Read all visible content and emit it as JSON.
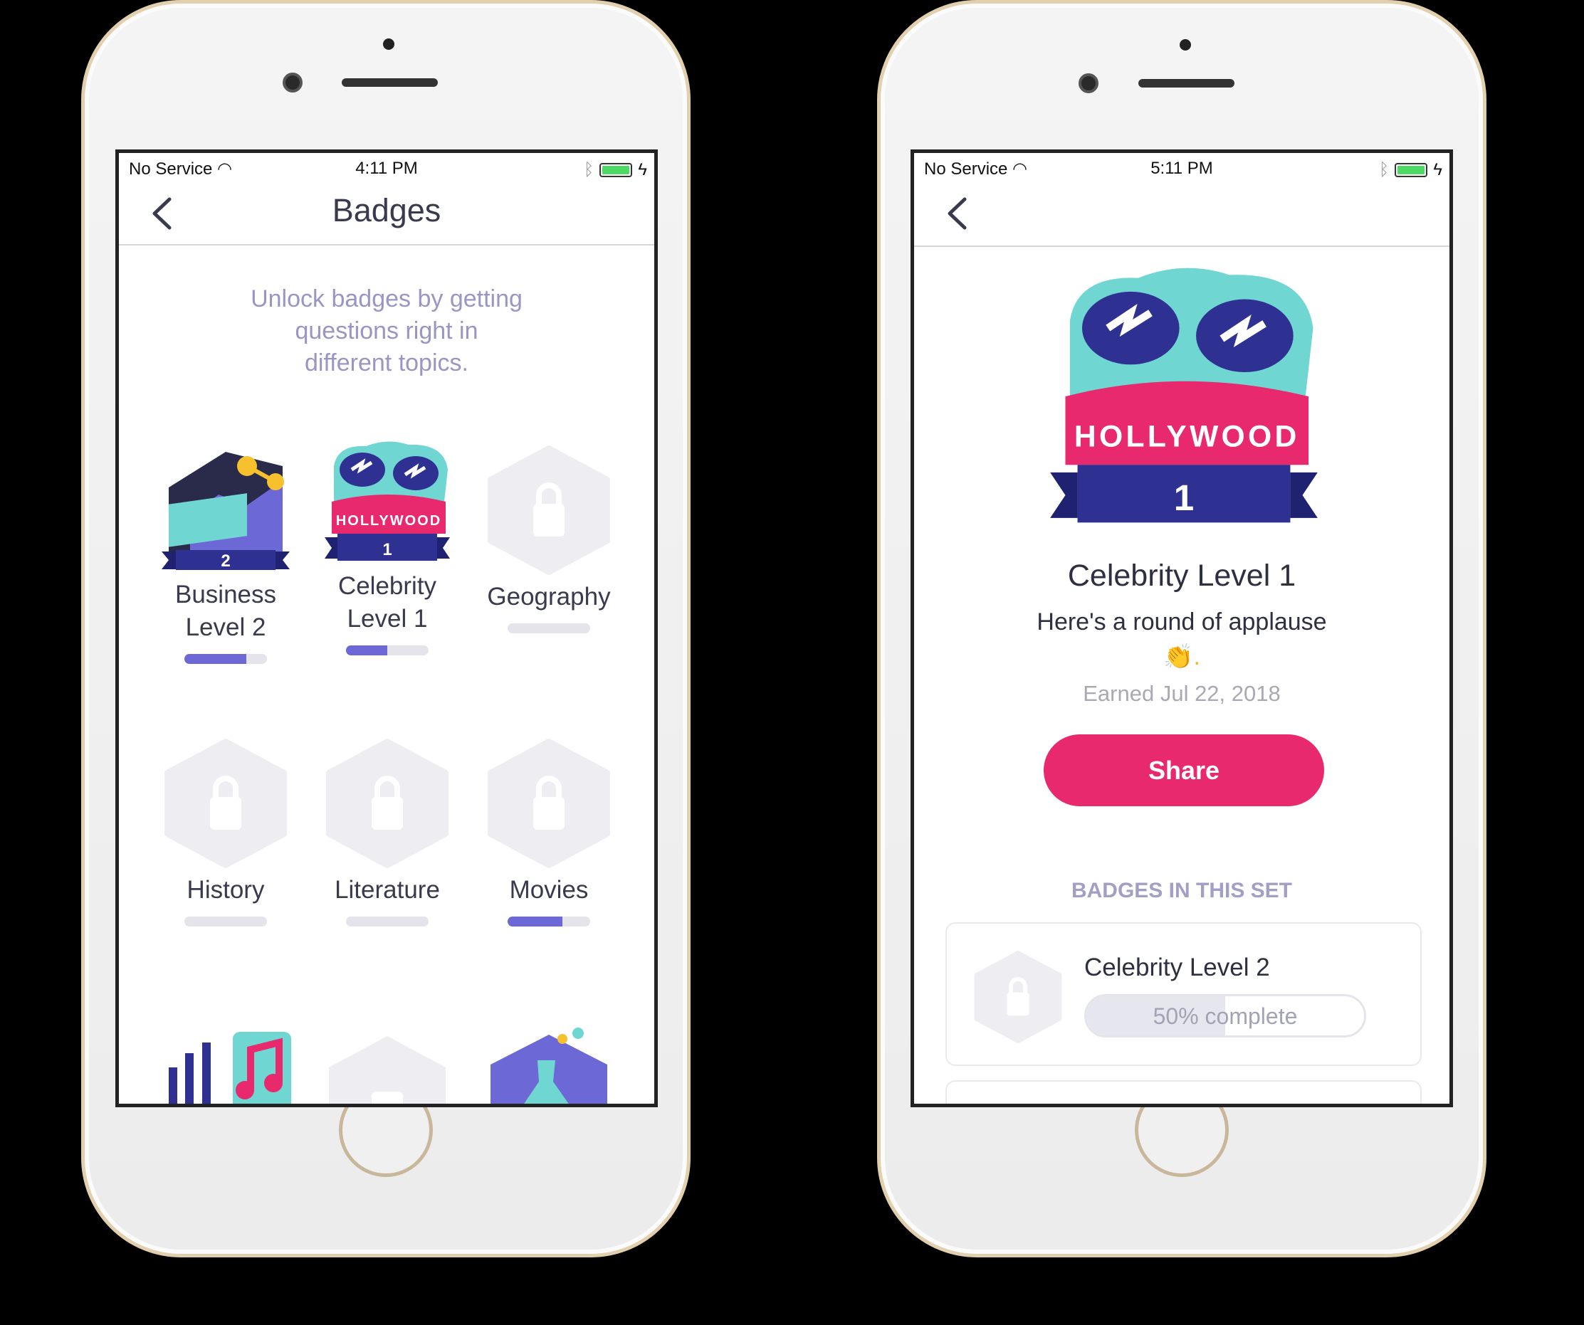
{
  "left": {
    "status": {
      "carrier": "No Service",
      "time": "4:11 PM"
    },
    "nav_title": "Badges",
    "intro": [
      "Unlock badges by getting",
      "questions right in",
      "different topics."
    ],
    "badges": [
      {
        "label": [
          "Business",
          "Level 2"
        ],
        "progress": 0.75,
        "icon": "business-badge",
        "level": "2"
      },
      {
        "label": [
          "Celebrity",
          "Level 1"
        ],
        "progress": 0.5,
        "icon": "hollywood-badge",
        "level": "1",
        "logo_text": "HOLLYWOOD"
      },
      {
        "label": [
          "Geography"
        ],
        "progress": 0,
        "icon": "locked-hex"
      },
      {
        "label": [
          "History"
        ],
        "progress": 0,
        "icon": "locked-hex"
      },
      {
        "label": [
          "Literature"
        ],
        "progress": 0,
        "icon": "locked-hex"
      },
      {
        "label": [
          "Movies"
        ],
        "progress": 0.66,
        "icon": "locked-hex"
      }
    ]
  },
  "right": {
    "status": {
      "carrier": "No Service",
      "time": "5:11 PM"
    },
    "badge": {
      "logo_text": "HOLLYWOOD",
      "level": "1"
    },
    "title": "Celebrity Level 1",
    "message": "Here's a round of applause",
    "emoji": "👏.",
    "earned": "Earned Jul 22, 2018",
    "share_label": "Share",
    "section_title": "BADGES IN THIS SET",
    "set_items": [
      {
        "title": "Celebrity Level 2",
        "progress": 0.5,
        "progress_label": "50% complete"
      }
    ]
  },
  "colors": {
    "accent": "#e8296e",
    "progress": "#6c68d6",
    "muted": "#9a95c4",
    "navy": "#2e3192",
    "teal": "#6fd6d2"
  }
}
